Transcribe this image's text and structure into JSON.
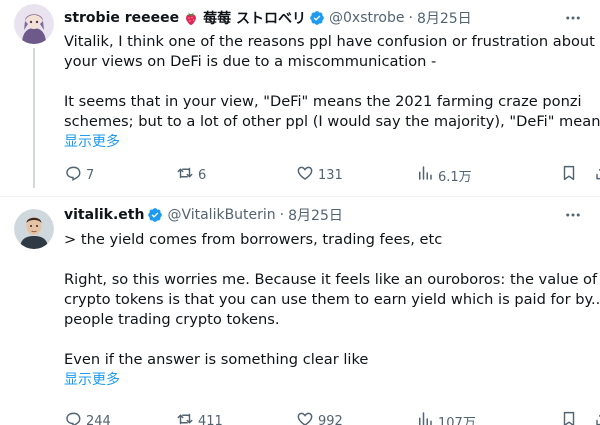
{
  "tweets": [
    {
      "author": {
        "name": "strobie reeeee",
        "name_suffix": "莓莓 ストロベリ",
        "handle": "@0xstrobe",
        "date": "8月25日"
      },
      "lines": [
        "Vitalik, I think one of the reasons ppl have confusion or frustration about",
        "your views on DeFi is due to a miscommunication -",
        "",
        "It seems that in your view, \"DeFi\" means the 2021 farming craze ponzi",
        "schemes; but to a lot of other ppl (I would say the majority), \"DeFi\" means"
      ],
      "show_more": "显示更多",
      "stats": {
        "replies": "7",
        "retweets": "6",
        "likes": "131",
        "views": "6.1万"
      }
    },
    {
      "author": {
        "name": "vitalik.eth",
        "handle": "@VitalikButerin",
        "date": "8月25日"
      },
      "lines": [
        "> the yield comes from borrowers, trading fees, etc",
        "",
        "Right, so this worries me. Because it feels like an ouroboros: the value of",
        "crypto tokens is that you can use them to earn yield which is paid for by...",
        "people trading crypto tokens.",
        "",
        "Even if the answer is something clear like"
      ],
      "show_more": "显示更多",
      "stats": {
        "replies": "244",
        "retweets": "411",
        "likes": "992",
        "views": "107万"
      }
    }
  ],
  "icons": {
    "verified": "verified-badge-icon",
    "more": "more-dots-icon",
    "reply": "reply-bubble-icon",
    "retweet": "retweet-icon",
    "like": "heart-icon",
    "views": "views-bar-icon",
    "bookmark": "bookmark-icon",
    "share": "share-upload-icon"
  },
  "colors": {
    "accent": "#1d9bf0",
    "muted": "#536471",
    "text": "#0f1419"
  }
}
